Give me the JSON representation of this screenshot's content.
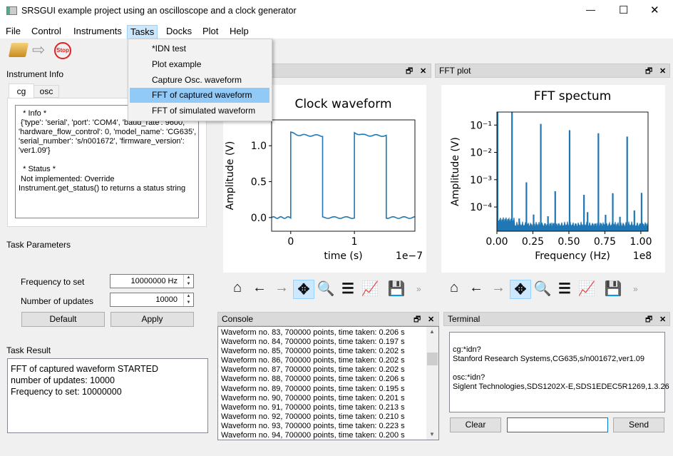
{
  "window": {
    "title": "SRSGUI example project using an oscilloscope and a clock generator",
    "minimize": "—",
    "maximize": "☐",
    "close": "✕"
  },
  "menubar": {
    "items": [
      "File",
      "Control",
      "Instruments",
      "Tasks",
      "Docks",
      "Plot",
      "Help"
    ],
    "active": "Tasks"
  },
  "tasks_menu": {
    "items": [
      "*IDN test",
      "Plot example",
      "Capture Osc. waveform",
      "FFT of captured waveform",
      "FFT of simulated waveform"
    ],
    "highlighted": "FFT of captured waveform"
  },
  "toolbar": {
    "open_icon": "folder-open-icon",
    "run_icon": "arrow-right-icon",
    "stop_label": "Stop"
  },
  "instrument_info": {
    "title": "Instrument Info",
    "tabs": [
      "cg",
      "osc"
    ],
    "active_tab": "cg",
    "text": [
      "  * Info *",
      " {'type': 'serial', 'port': 'COM4', 'baud_rate': 9600,",
      "'hardware_flow_control': 0, 'model_name': 'CG635',",
      "'serial_number': 's/n001672', 'firmware_version':",
      "'ver1.09'}",
      "",
      "  * Status *",
      " Not implemented: Override",
      "Instrument.get_status() to returns a status string"
    ]
  },
  "task_parameters": {
    "title": "Task Parameters",
    "frequency_label": "Frequency to set",
    "frequency_value": "10000000 Hz",
    "updates_label": "Number of updates",
    "updates_value": "10000",
    "default_button": "Default",
    "apply_button": "Apply"
  },
  "task_result": {
    "title": "Task Result",
    "lines": [
      "FFT of captured waveform STARTED",
      "number of updates: 10000",
      "Frequency to set: 10000000"
    ]
  },
  "fft_dock": {
    "title": "FFT plot"
  },
  "plot_toolbar": {
    "icons": [
      "home-icon",
      "back-icon",
      "forward-icon",
      "pan-icon",
      "zoom-icon",
      "configure-subplots-icon",
      "edit-axis-icon",
      "save-icon"
    ],
    "more": "»"
  },
  "chart_data": [
    {
      "type": "line",
      "title": "Clock waveform",
      "xlabel": "time (s)",
      "ylabel": "Amplitude (V)",
      "x_offset_label": "1e−7",
      "xlim": [
        -3e-08,
        1.95e-07
      ],
      "ylim": [
        -0.19,
        1.36
      ],
      "xticks": [
        "0",
        "1"
      ],
      "yticks": [
        "0.0",
        "0.5",
        "1.0"
      ],
      "color": "#1f77b4",
      "segments": [
        {
          "from": -3e-08,
          "to": 0,
          "level": 0.0
        },
        {
          "from": 0,
          "to": 5e-08,
          "level": 1.15
        },
        {
          "from": 5e-08,
          "to": 1e-07,
          "level": 0.0
        },
        {
          "from": 1e-07,
          "to": 1.5e-07,
          "level": 1.15
        },
        {
          "from": 1.5e-07,
          "to": 1.95e-07,
          "level": 0.0
        }
      ]
    },
    {
      "type": "line",
      "title": "FFT spectum",
      "xlabel": "Frequency (Hz)",
      "ylabel": "Amplitude (V)",
      "x_offset_label": "1e8",
      "xlim": [
        0,
        105000000.0
      ],
      "ylim": [
        1.3e-05,
        0.3
      ],
      "yscale": "log",
      "xticks": [
        "0.00",
        "0.25",
        "0.50",
        "0.75",
        "1.00"
      ],
      "yticks": [
        "10⁻¹",
        "10⁻²",
        "10⁻³",
        "10⁻⁴"
      ],
      "color": "#1f77b4",
      "noise_floor": 2.2e-05,
      "peaks": [
        [
          0,
          0.3
        ],
        [
          10000000.0,
          0.3
        ],
        [
          15000000.0,
          3.8e-05
        ],
        [
          20000000.0,
          0.0008
        ],
        [
          25000000.0,
          5.3e-05
        ],
        [
          30000000.0,
          0.11
        ],
        [
          35000000.0,
          4.6e-05
        ],
        [
          40000000.0,
          0.00038
        ],
        [
          50000000.0,
          0.065
        ],
        [
          60000000.0,
          0.00028
        ],
        [
          62500000.0,
          6.5e-05
        ],
        [
          70000000.0,
          0.05
        ],
        [
          75000000.0,
          5.2e-05
        ],
        [
          80000000.0,
          0.00032
        ],
        [
          85000000.0,
          4.4e-05
        ],
        [
          90000000.0,
          0.038
        ],
        [
          95000000.0,
          7.5e-05
        ],
        [
          100000000.0,
          0.00033
        ]
      ]
    }
  ],
  "console": {
    "title": "Console",
    "lines": [
      "Waveform no. 83, 700000 points, time taken: 0.206 s",
      "Waveform no. 84, 700000 points, time taken: 0.197 s",
      "Waveform no. 85, 700000 points, time taken: 0.202 s",
      "Waveform no. 86, 700000 points, time taken: 0.202 s",
      "Waveform no. 87, 700000 points, time taken: 0.202 s",
      "Waveform no. 88, 700000 points, time taken: 0.206 s",
      "Waveform no. 89, 700000 points, time taken: 0.195 s",
      "Waveform no. 90, 700000 points, time taken: 0.201 s",
      "Waveform no. 91, 700000 points, time taken: 0.213 s",
      "Waveform no. 92, 700000 points, time taken: 0.210 s",
      "Waveform no. 93, 700000 points, time taken: 0.223 s",
      "Waveform no. 94, 700000 points, time taken: 0.200 s"
    ]
  },
  "terminal": {
    "title": "Terminal",
    "lines": [
      "cg:*idn?",
      "Stanford Research Systems,CG635,s/n001672,ver1.09",
      "",
      "osc:*idn?",
      "Siglent Technologies,SDS1202X-E,SDS1EDEC5R1269,1.3.26"
    ],
    "clear_button": "Clear",
    "input_value": "",
    "send_button": "Send"
  }
}
